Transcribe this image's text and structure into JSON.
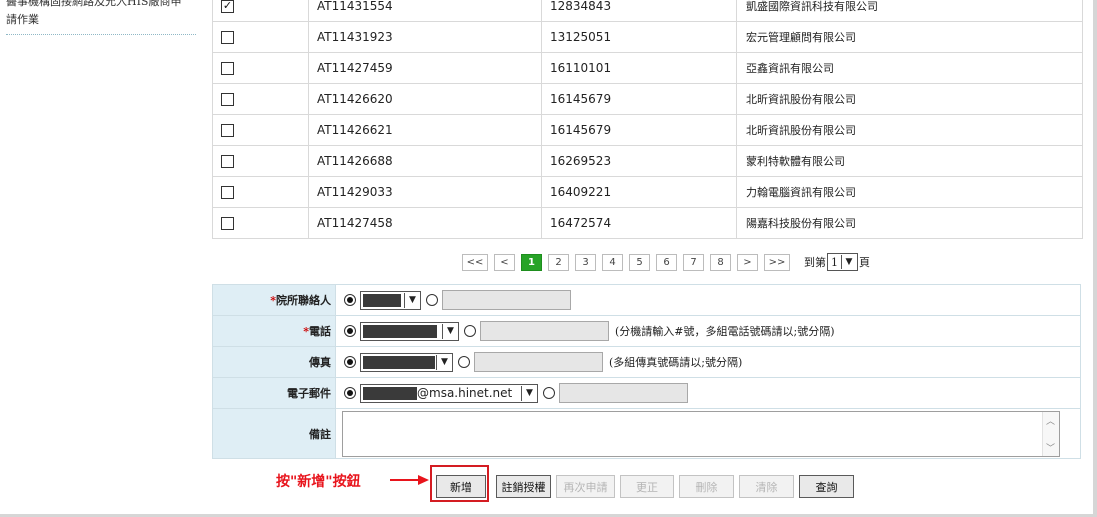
{
  "sidebar": {
    "text": "醫事機構固接網路及允入HIS廠商申請作業"
  },
  "results": {
    "rows": [
      {
        "checked": true,
        "number": "AT11431554",
        "id": "12834843",
        "name": "凱盛國際資訊科技有限公司"
      },
      {
        "checked": false,
        "number": "AT11431923",
        "id": "13125051",
        "name": "宏元管理顧問有限公司"
      },
      {
        "checked": false,
        "number": "AT11427459",
        "id": "16110101",
        "name": "亞鑫資訊有限公司"
      },
      {
        "checked": false,
        "number": "AT11426620",
        "id": "16145679",
        "name": "北昕資訊股份有限公司"
      },
      {
        "checked": false,
        "number": "AT11426621",
        "id": "16145679",
        "name": "北昕資訊股份有限公司"
      },
      {
        "checked": false,
        "number": "AT11426688",
        "id": "16269523",
        "name": "蒙利特軟體有限公司"
      },
      {
        "checked": false,
        "number": "AT11429033",
        "id": "16409221",
        "name": "力翰電腦資訊有限公司"
      },
      {
        "checked": false,
        "number": "AT11427458",
        "id": "16472574",
        "name": "陽嘉科技股份有限公司"
      }
    ]
  },
  "pagination": {
    "first": "<<",
    "prev": "<",
    "pages": [
      "1",
      "2",
      "3",
      "4",
      "5",
      "6",
      "7",
      "8"
    ],
    "current": "1",
    "next": ">",
    "last": ">>",
    "jump_prefix": "到第",
    "jump_value": "1",
    "jump_suffix": "頁"
  },
  "form": {
    "contact": {
      "required_mark": "*",
      "label": "院所聯絡人"
    },
    "phone": {
      "required_mark": "*",
      "label": "電話",
      "hint": "(分機請輸入#號，多組電話號碼請以;號分隔)"
    },
    "fax": {
      "label": "傳真",
      "hint": "(多組傳真號碼請以;號分隔)"
    },
    "email": {
      "label": "電子郵件",
      "domain": "@msa.hinet.net"
    },
    "note": {
      "label": "備註"
    }
  },
  "annotation": {
    "text": "按\"新增\"按鈕",
    "color": "#e8141c"
  },
  "buttons": {
    "add": "新增",
    "cancel_auth": "註銷授權",
    "reapply": "再次申請",
    "modify": "更正",
    "delete": "刪除",
    "clear": "清除",
    "query": "查詢"
  },
  "colors": {
    "label_bg": "#dfeef5",
    "current_page": "#27a327",
    "highlight_box": "#d41c22"
  },
  "icons": {
    "checkbox": "checkbox-icon",
    "radio": "radio-icon",
    "dropdown": "chevron-down-icon",
    "arrow": "arrow-right-icon"
  }
}
